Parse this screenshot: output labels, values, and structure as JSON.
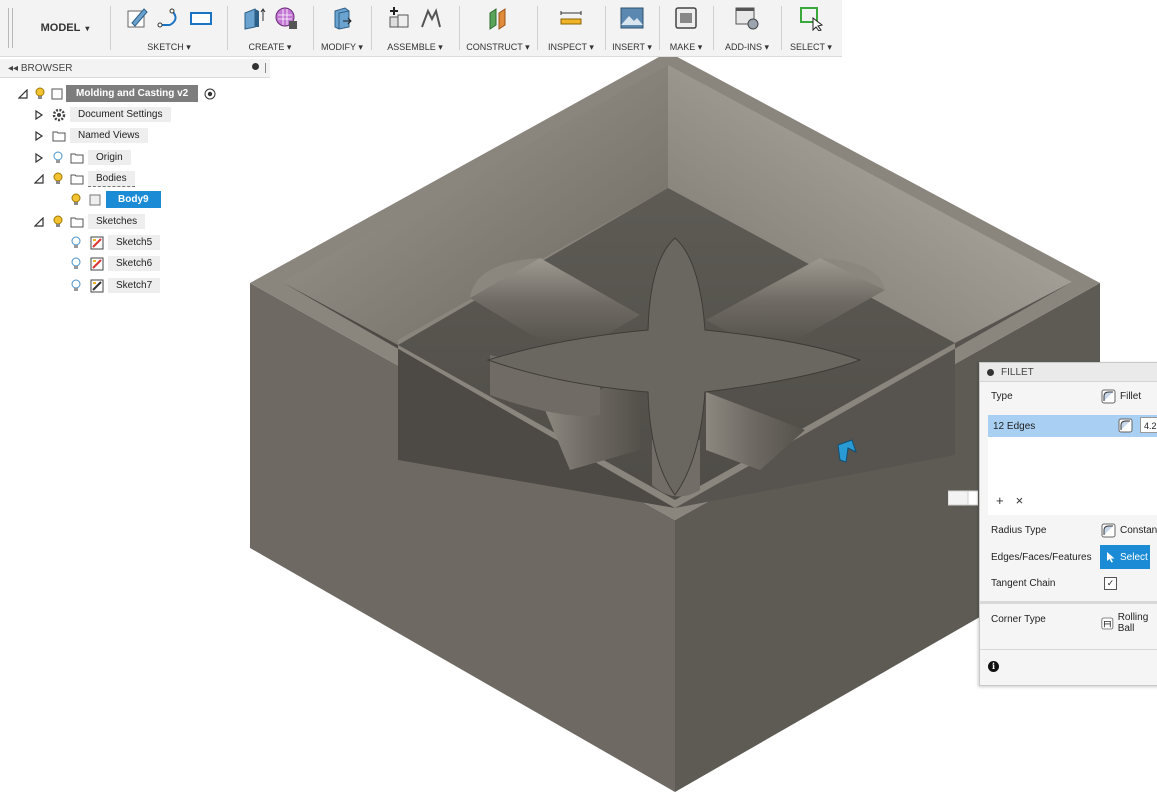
{
  "toolbar": {
    "workspace": "MODEL",
    "groups": [
      {
        "label": "SKETCH"
      },
      {
        "label": "CREATE"
      },
      {
        "label": "MODIFY"
      },
      {
        "label": "ASSEMBLE"
      },
      {
        "label": "CONSTRUCT"
      },
      {
        "label": "INSPECT"
      },
      {
        "label": "INSERT"
      },
      {
        "label": "MAKE"
      },
      {
        "label": "ADD-INS"
      },
      {
        "label": "SELECT"
      }
    ],
    "dropdown_glyph": "▾"
  },
  "browser": {
    "title": "BROWSER",
    "collapse_glyph": "◂◂",
    "root": "Molding and Casting v2",
    "items": [
      {
        "label": "Document Settings",
        "icon": "gear-icon"
      },
      {
        "label": "Named Views",
        "icon": "folder-icon"
      },
      {
        "label": "Origin",
        "icon": "folder-icon"
      },
      {
        "label": "Bodies",
        "icon": "folder-icon"
      },
      {
        "label": "Body9",
        "icon": "body-icon"
      },
      {
        "label": "Sketches",
        "icon": "folder-icon"
      },
      {
        "label": "Sketch5",
        "icon": "sketch-icon"
      },
      {
        "label": "Sketch6",
        "icon": "sketch-icon"
      },
      {
        "label": "Sketch7",
        "icon": "sketch-icon"
      }
    ]
  },
  "fillet": {
    "title": "FILLET",
    "type_label": "Type",
    "type_value": "Fillet",
    "edges_label": "12 Edges",
    "edges_radius": "4.2",
    "add_glyph": "+",
    "remove_glyph": "×",
    "radius_type_label": "Radius Type",
    "radius_type_value": "Constant",
    "selection_label": "Edges/Faces/Features",
    "select_button": "Select",
    "tangent_label": "Tangent Chain",
    "tangent_checked": "✓",
    "corner_label": "Corner Type",
    "corner_value": "Rolling Ball",
    "info_glyph": "i"
  },
  "colors": {
    "accent": "#1a8bd4",
    "box_front": "#6e6a63",
    "box_side": "#5b5852",
    "box_top": "#8a857d"
  }
}
